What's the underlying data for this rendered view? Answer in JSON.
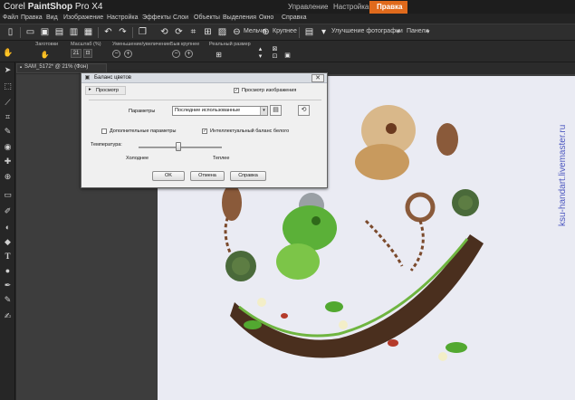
{
  "app": {
    "title_plain": "Corel ",
    "title_bold": "PaintShop",
    "title_suffix": " Pro X4"
  },
  "workspace_tabs": [
    {
      "label": "Управление"
    },
    {
      "label": "Настройка"
    },
    {
      "label": "Правка",
      "active": true
    }
  ],
  "menu": [
    "Файл",
    "Правка",
    "Вид",
    "Изображение",
    "Настройка",
    "Эффекты",
    "Слои",
    "Объекты",
    "Выделения",
    "Окно",
    "Справка"
  ],
  "toolbar": {
    "shrink_label": "Мельче",
    "enlarge_label": "Крупнее",
    "enhance_label": "Улучшение фотографии",
    "panels_label": "Панели"
  },
  "tool_options": {
    "presets_label": "Заготовки",
    "scale_label": "Масштаб (%)",
    "scale_value": "21",
    "zoom_label": "Уменьшение/увеличение",
    "quick_label": "Быв крупнее",
    "actual_label": "Реальный размер"
  },
  "document": {
    "tab_label": "SAM_5172* @ 21% (Фон)"
  },
  "dialog": {
    "title": "Баланс цветов",
    "preview_toggle": "Просмотр",
    "preview_image": "Просмотр изображения",
    "params_label": "Параметры",
    "params_value": "Последние использованные",
    "advanced": "Дополнительные параметры",
    "smart_white": "Интеллектуальный баланс белого",
    "temperature_label": "Температура:",
    "colder": "Холоднее",
    "warmer": "Теплее",
    "temperature_value": 0.48,
    "ok": "OK",
    "cancel": "Отмена",
    "help": "Справка"
  },
  "colors": {
    "accent": "#e06a1c",
    "background": "#2b2b2b"
  },
  "watermark": "ksu-handart.livemaster.ru"
}
